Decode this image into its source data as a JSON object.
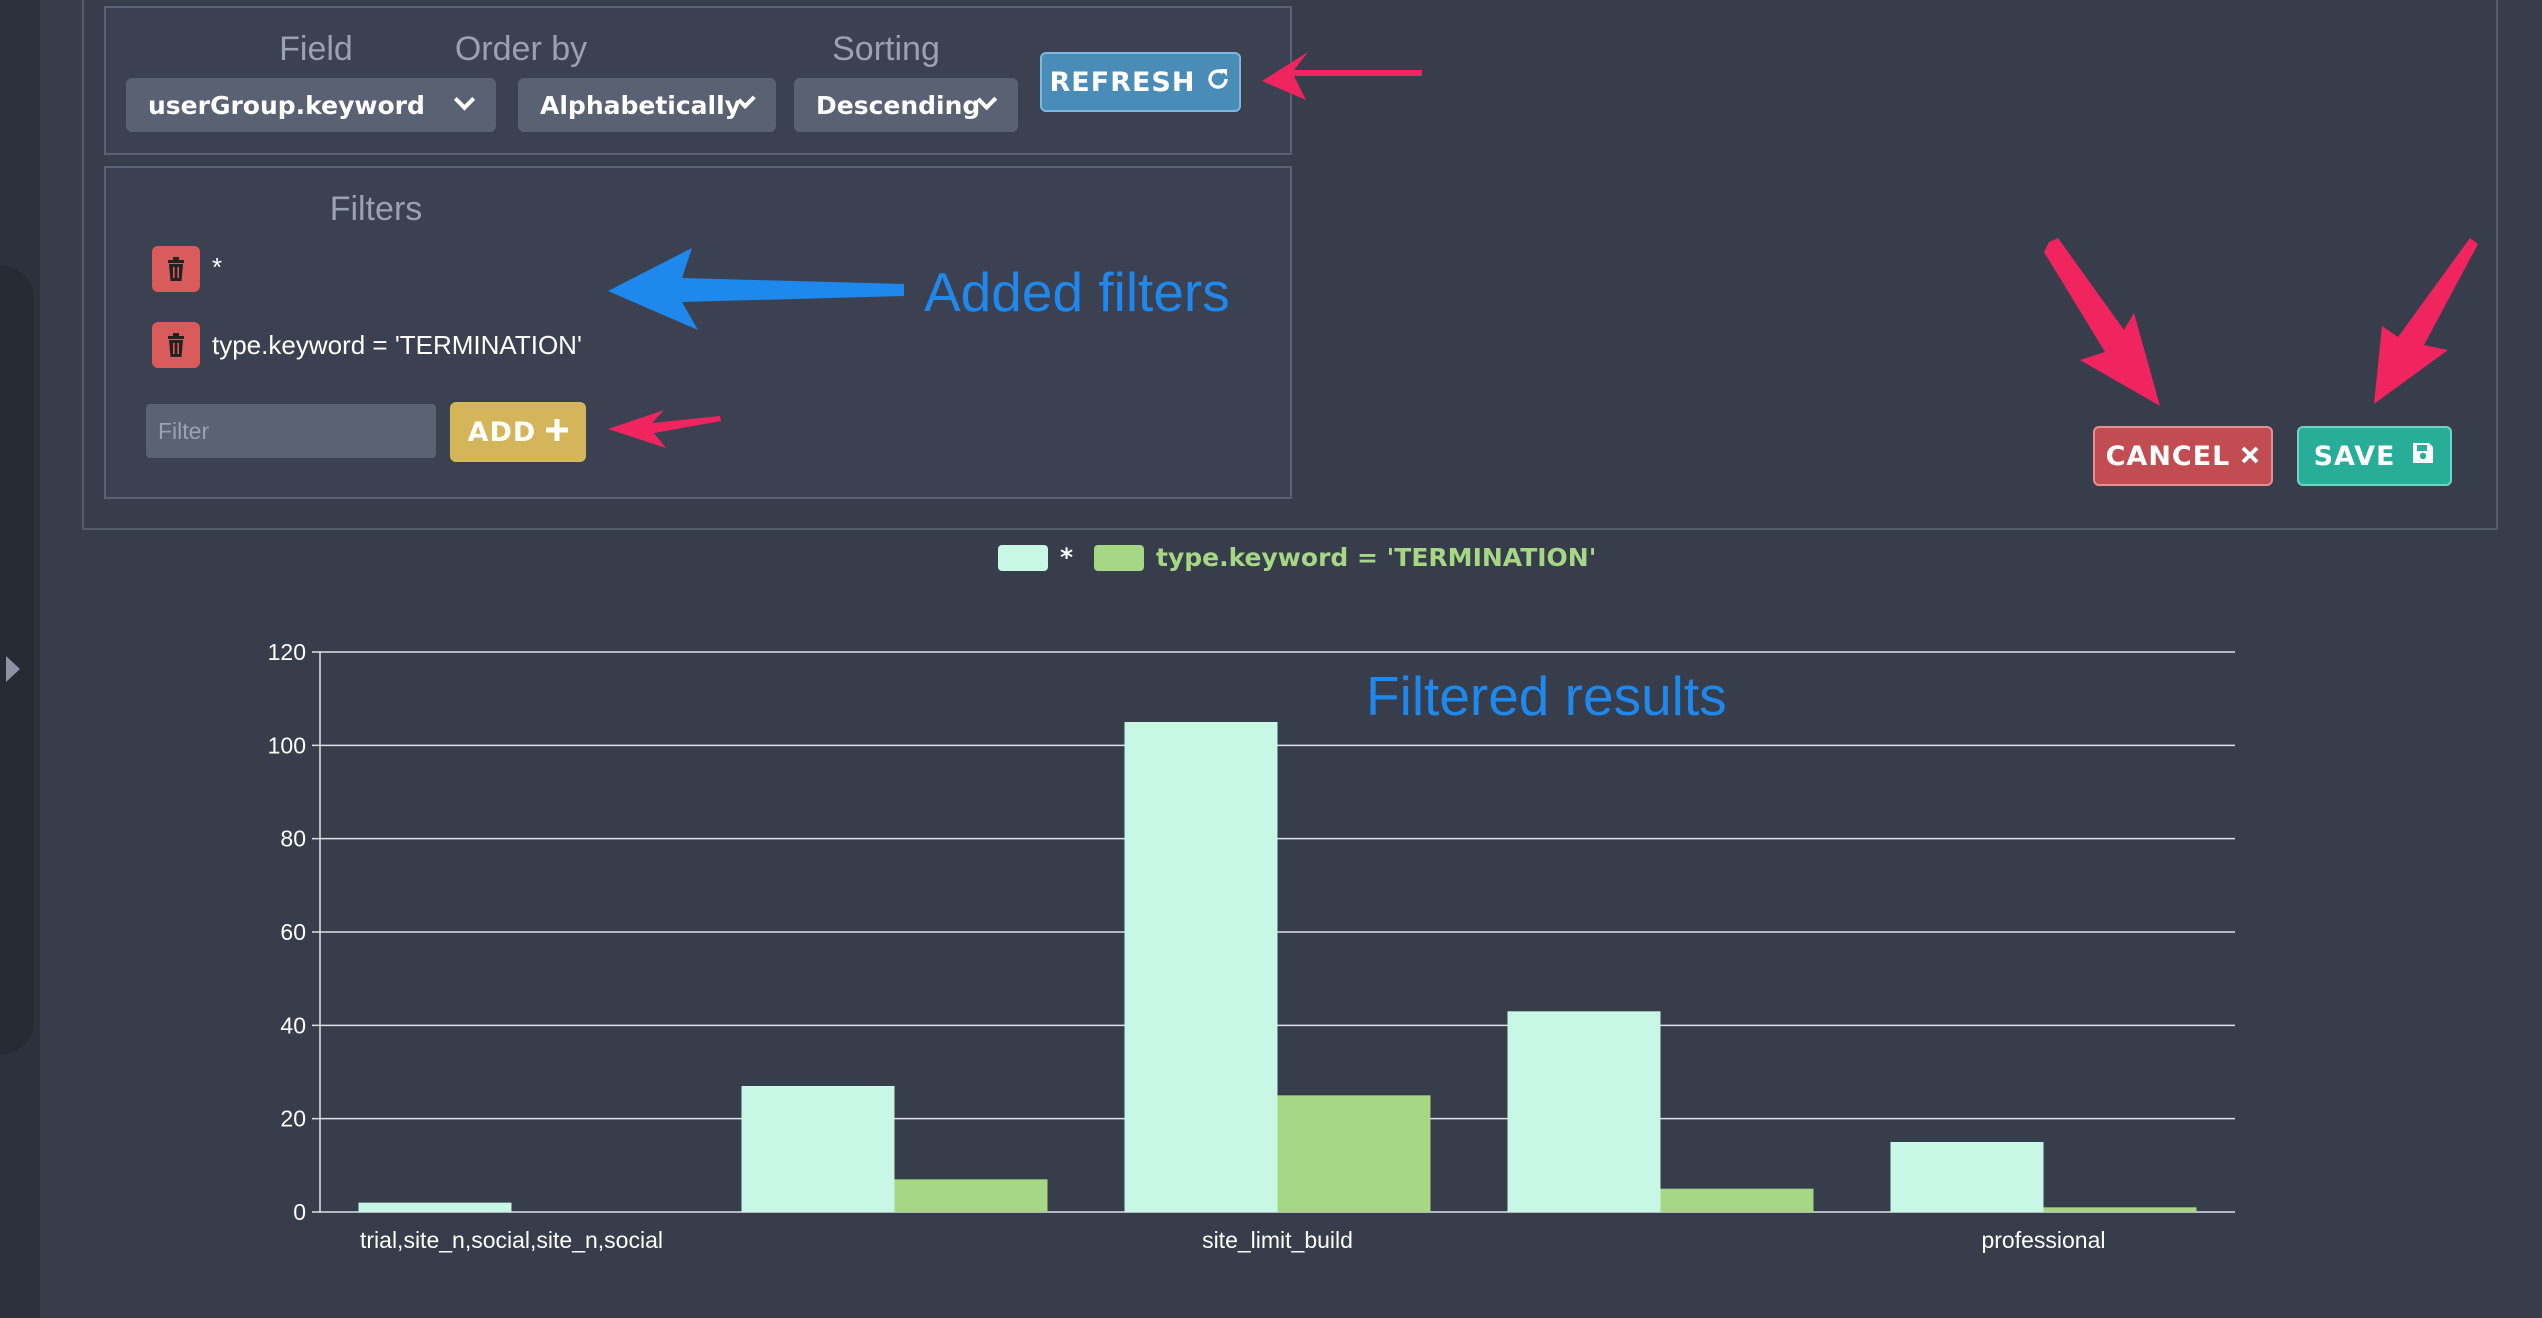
{
  "controls": {
    "field_label": "Field",
    "field_value": "userGroup.keyword",
    "order_label": "Order by",
    "order_value": "Alphabetically",
    "sorting_label": "Sorting",
    "sorting_value": "Descending",
    "refresh_label": "REFRESH"
  },
  "filters": {
    "title": "Filters",
    "items": [
      {
        "text": "*"
      },
      {
        "text": "type.keyword = 'TERMINATION'"
      }
    ],
    "input_placeholder": "Filter",
    "add_label": "ADD"
  },
  "actions": {
    "cancel_label": "CANCEL",
    "save_label": "SAVE"
  },
  "annotations": {
    "added_filters": "Added filters",
    "filtered_results": "Filtered results"
  },
  "colors": {
    "series_all": "#c8f7e6",
    "series_termination": "#a6d785",
    "annotation_pink": "#f0245f",
    "annotation_blue": "#1e88ec"
  },
  "icons": [
    "chevron-down-icon",
    "refresh-icon",
    "trash-icon",
    "plus-icon",
    "close-icon",
    "save-icon",
    "sidebar-toggle-icon"
  ],
  "chart_data": {
    "type": "bar",
    "categories": [
      "trial,site_n,social,site_n,social",
      "",
      "site_limit_build",
      "",
      "professional"
    ],
    "series": [
      {
        "name": "*",
        "color": "#c8f7e6",
        "values": [
          2,
          27,
          105,
          43,
          15
        ]
      },
      {
        "name": "type.keyword = 'TERMINATION'",
        "color": "#a6d785",
        "values": [
          0,
          7,
          25,
          5,
          1
        ]
      }
    ],
    "ylim": [
      0,
      120
    ],
    "yticks": [
      0,
      20,
      40,
      60,
      80,
      100,
      120
    ],
    "grid": true,
    "legend": "top-center"
  }
}
